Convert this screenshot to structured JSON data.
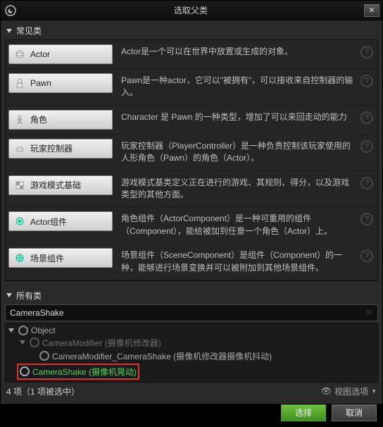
{
  "window": {
    "title": "选取父类"
  },
  "sections": {
    "common_label": "常见类",
    "all_label": "所有类"
  },
  "common_classes": [
    {
      "label": "Actor",
      "desc": "Actor是一个可以在世界中放置或生成的对象。"
    },
    {
      "label": "Pawn",
      "desc": "Pawn是一种actor，它可以\"被拥有\"，可以接收来自控制器的输入。"
    },
    {
      "label": "角色",
      "desc": "Character 是 Pawn 的一种类型，增加了可以来回走动的能力"
    },
    {
      "label": "玩家控制器",
      "desc": "玩家控制器（PlayerController）是一种负责控制该玩家使用的人形角色（Pawn）的角色（Actor）。"
    },
    {
      "label": "游戏模式基础",
      "desc": "游戏模式基类定义正在进行的游戏、其规则、得分，以及游戏类型的其他方面。"
    },
    {
      "label": "Actor组件",
      "desc": "角色组件（ActorComponent）是一种可重用的组件（Component），能给被加到任意一个角色（Actor）上。"
    },
    {
      "label": "场景组件",
      "desc": "场景组件（SceneComponent）是组件（Component）的一种，能够进行场景变换并可以被附加到其他场景组件。"
    }
  ],
  "search": {
    "value": "CameraShake",
    "clear_icon": "×"
  },
  "tree": {
    "root": "Object",
    "modifier": "CameraModifier (摄像机修改器)",
    "modifier_shake": "CameraModifier_CameraShake (摄像机修改器摄像机抖动)",
    "camera_shake": "CameraShake (摄像机晃动)"
  },
  "summary": "4 项（1 项被选中）",
  "view_options": "视图选项",
  "buttons": {
    "select": "选择",
    "cancel": "取消"
  }
}
